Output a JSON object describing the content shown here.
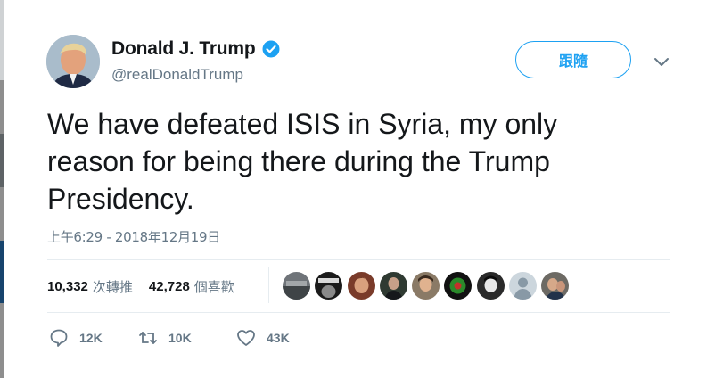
{
  "author": {
    "display_name": "Donald J. Trump",
    "handle": "@realDonaldTrump",
    "verified": true,
    "avatar_icon": "profile-photo"
  },
  "follow_button": {
    "label": "跟隨"
  },
  "tweet": {
    "lines": [
      "We have defeated ISIS in Syria, my only",
      "reason for being there during the Trump",
      "Presidency."
    ],
    "timestamp": "上午6:29 - 2018年12月19日"
  },
  "stats": {
    "retweets": {
      "count": "10,332",
      "label": "次轉推"
    },
    "likes": {
      "count": "42,728",
      "label": "個喜歡"
    }
  },
  "liker_avatars": 9,
  "actions": {
    "reply": {
      "icon": "reply-icon",
      "count": "12K"
    },
    "retweet": {
      "icon": "retweet-icon",
      "count": "10K"
    },
    "like": {
      "icon": "heart-icon",
      "count": "43K"
    }
  },
  "colors": {
    "accent": "#1da1f2",
    "secondary_text": "#657786",
    "divider": "#e6ecf0"
  }
}
